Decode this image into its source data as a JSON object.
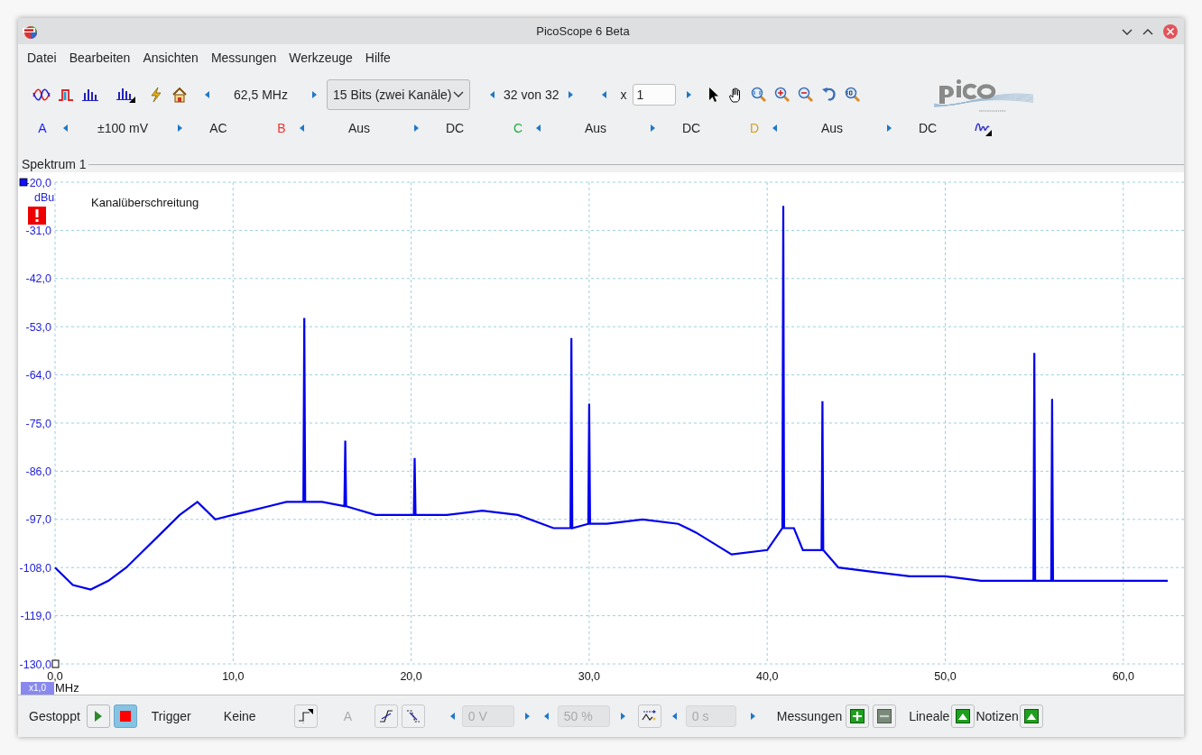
{
  "window": {
    "title": "PicoScope 6 Beta"
  },
  "menu": [
    "Datei",
    "Bearbeiten",
    "Ansichten",
    "Messungen",
    "Werkzeuge",
    "Hilfe"
  ],
  "toolbar": {
    "sample_rate": "62,5 MHz",
    "resolution": "15 Bits (zwei Kanäle)",
    "buffer": "32 von 32",
    "zoom_label": "x",
    "zoom_value": "1"
  },
  "channels": [
    {
      "letter": "A",
      "color": "#1a1aff",
      "range": "±100 mV",
      "coupling": "AC"
    },
    {
      "letter": "B",
      "color": "#ee3333",
      "range": "Aus",
      "coupling": "DC"
    },
    {
      "letter": "C",
      "color": "#22aa44",
      "range": "Aus",
      "coupling": "DC"
    },
    {
      "letter": "D",
      "color": "#d4a020",
      "range": "Aus",
      "coupling": "DC"
    }
  ],
  "view_tab": "Spektrum 1",
  "spectrum": {
    "warning": "Kanalüberschreitung",
    "unit": "dBu",
    "x_scale": "x1,0",
    "x_unit": "MHz",
    "chart_data": {
      "type": "line",
      "grid": true,
      "xlim": [
        0,
        63.4
      ],
      "ylim": [
        -130,
        -20
      ],
      "xticks": [
        {
          "value": 0,
          "label": "0,0"
        },
        {
          "value": 10,
          "label": "10,0"
        },
        {
          "value": 20,
          "label": "20,0"
        },
        {
          "value": 30,
          "label": "30,0"
        },
        {
          "value": 40,
          "label": "40,0"
        },
        {
          "value": 50,
          "label": "50,0"
        },
        {
          "value": 60,
          "label": "60,0"
        }
      ],
      "yticks": [
        {
          "value": -20,
          "label": "-20,0"
        },
        {
          "value": -31,
          "label": "-31,0"
        },
        {
          "value": -42,
          "label": "-42,0"
        },
        {
          "value": -53,
          "label": "-53,0"
        },
        {
          "value": -64,
          "label": "-64,0"
        },
        {
          "value": -75,
          "label": "-75,0"
        },
        {
          "value": -86,
          "label": "-86,0"
        },
        {
          "value": -97,
          "label": "-97,0"
        },
        {
          "value": -108,
          "label": "-108,0"
        },
        {
          "value": -119,
          "label": "-119,0"
        },
        {
          "value": -130,
          "label": "-130,0"
        }
      ],
      "x": [
        0,
        1,
        2,
        3,
        4,
        5,
        6,
        7,
        8,
        9,
        10,
        11,
        12,
        13,
        13.95,
        14,
        14.05,
        15,
        16.25,
        16.3,
        16.35,
        18,
        20,
        20.15,
        20.2,
        20.25,
        22,
        24,
        26,
        28,
        28.95,
        29,
        29.05,
        29.95,
        30,
        30.05,
        31,
        33,
        35,
        36,
        38,
        40,
        40.85,
        40.9,
        40.95,
        41.5,
        42,
        43.05,
        43.1,
        43.15,
        44,
        46,
        48,
        50,
        52,
        54,
        54.95,
        55,
        55.05,
        55.95,
        56,
        56.05,
        58,
        60,
        62.5
      ],
      "series": [
        {
          "color": "#0000ee",
          "values": [
            -108,
            -112,
            -113,
            -111,
            -108,
            -104,
            -100,
            -96,
            -93,
            -97,
            -96,
            -95,
            -94,
            -93,
            -93,
            -51,
            -93,
            -93,
            -94,
            -79,
            -94,
            -96,
            -96,
            -96,
            -83,
            -96,
            -96,
            -95,
            -96,
            -99,
            -99,
            -55.6,
            -99,
            -98,
            -70.6,
            -98,
            -98,
            -97,
            -98,
            -100,
            -105,
            -104,
            -99,
            -25.4,
            -99,
            -99,
            -104,
            -104,
            -70,
            -104,
            -108,
            -109,
            -110,
            -110,
            -111,
            -111,
            -111,
            -59,
            -111,
            -111,
            -69.5,
            -111,
            -111,
            -111,
            -111
          ]
        }
      ]
    }
  },
  "bottom": {
    "status": "Gestoppt",
    "run_buttons": [
      {
        "kind": "play",
        "selected": false
      },
      {
        "kind": "stop",
        "selected": true
      }
    ],
    "trigger_label": "Trigger",
    "trigger_mode": "Keine",
    "trigger_source": {
      "text": "A",
      "disabled": true
    },
    "fields": [
      {
        "value": "0 V",
        "disabled": true
      },
      {
        "value": "50 %",
        "disabled": true
      },
      {
        "value": "0 s",
        "disabled": true
      }
    ],
    "measurements": "Messungen",
    "rulers": "Lineale",
    "notes": "Notizen"
  }
}
